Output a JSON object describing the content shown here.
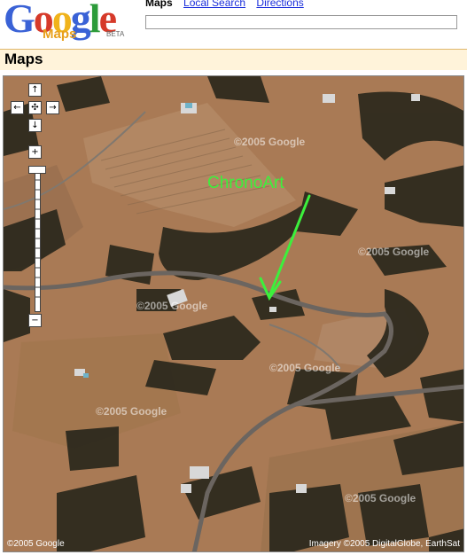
{
  "logo": {
    "wordmark": "Google",
    "product": "Maps",
    "badge": "BETA"
  },
  "nav": {
    "active": "Maps",
    "links": [
      "Local Search",
      "Directions"
    ]
  },
  "search": {
    "value": ""
  },
  "title": "Maps",
  "map": {
    "controls": {
      "pan_up": "↑",
      "pan_left": "←",
      "pan_reset": "✣",
      "pan_right": "→",
      "pan_down": "↓",
      "zoom_in": "+",
      "zoom_out": "−"
    },
    "watermarks": [
      "©2005 Google",
      "©2005 Google",
      "©2005 Google",
      "©2005 Google",
      "©2005 Google",
      "©2005 Google"
    ],
    "annotation": "ChronoArt",
    "credit_left": "©2005 Google",
    "credit_right": "Imagery ©2005 DigitalGlobe, EarthSat"
  },
  "colors": {
    "ground": "#a97a55",
    "trees": "#2e2a1e",
    "road": "#6b6560",
    "annotation": "#3cf03c"
  }
}
